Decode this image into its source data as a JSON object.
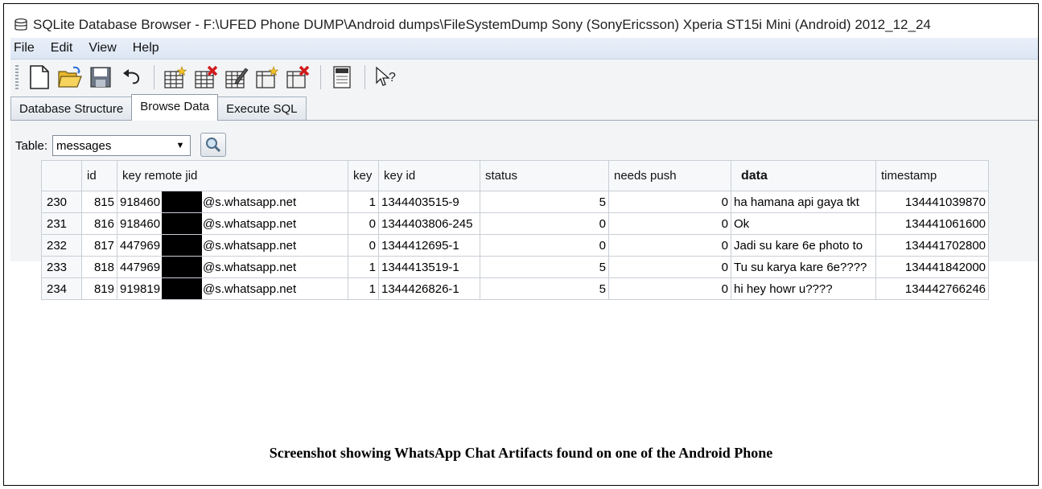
{
  "window": {
    "title": "SQLite Database Browser - F:\\UFED Phone DUMP\\Android dumps\\FileSystemDump Sony (SonyEricsson) Xperia ST15i Mini (Android) 2012_12_24"
  },
  "menu": [
    "File",
    "Edit",
    "View",
    "Help"
  ],
  "toolbar": {
    "icons": [
      "new-database-icon",
      "open-database-icon",
      "save-icon",
      "undo-icon",
      "create-table-icon",
      "delete-table-icon",
      "modify-table-icon",
      "create-index-icon",
      "delete-index-icon",
      "sql-log-icon",
      "whats-this-icon"
    ]
  },
  "tabs": [
    "Database Structure",
    "Browse Data",
    "Execute SQL"
  ],
  "active_tab": "Browse Data",
  "table_selector": {
    "label": "Table:",
    "value": "messages"
  },
  "grid": {
    "columns": [
      "",
      "id",
      "key remote jid",
      "key",
      "key id",
      "status",
      "needs push",
      "data",
      "timestamp"
    ],
    "rows": [
      {
        "row": "230",
        "id": "815",
        "jid_prefix": "918460",
        "jid_suffix": "@s.whatsapp.net",
        "key": "1",
        "key_id": "1344403515-9",
        "status": "5",
        "needs_push": "0",
        "data": "ha hamana api gaya tkt",
        "timestamp": "134441039870"
      },
      {
        "row": "231",
        "id": "816",
        "jid_prefix": "918460",
        "jid_suffix": "@s.whatsapp.net",
        "key": "0",
        "key_id": "1344403806-245",
        "status": "0",
        "needs_push": "0",
        "data": "Ok",
        "timestamp": "134441061600"
      },
      {
        "row": "232",
        "id": "817",
        "jid_prefix": "447969",
        "jid_suffix": "@s.whatsapp.net",
        "key": "0",
        "key_id": "1344412695-1",
        "status": "0",
        "needs_push": "0",
        "data": "Jadi su kare 6e photo to",
        "timestamp": "134441702800"
      },
      {
        "row": "233",
        "id": "818",
        "jid_prefix": "447969",
        "jid_suffix": "@s.whatsapp.net",
        "key": "1",
        "key_id": "1344413519-1",
        "status": "5",
        "needs_push": "0",
        "data": "Tu su karya kare 6e????",
        "timestamp": "134441842000"
      },
      {
        "row": "234",
        "id": "819",
        "jid_prefix": "919819",
        "jid_suffix": "@s.whatsapp.net",
        "key": "1",
        "key_id": "1344426826-1",
        "status": "5",
        "needs_push": "0",
        "data": "hi hey howr u????",
        "timestamp": "134442766246"
      }
    ]
  },
  "caption": "Screenshot showing WhatsApp Chat Artifacts found on one of the Android Phone"
}
